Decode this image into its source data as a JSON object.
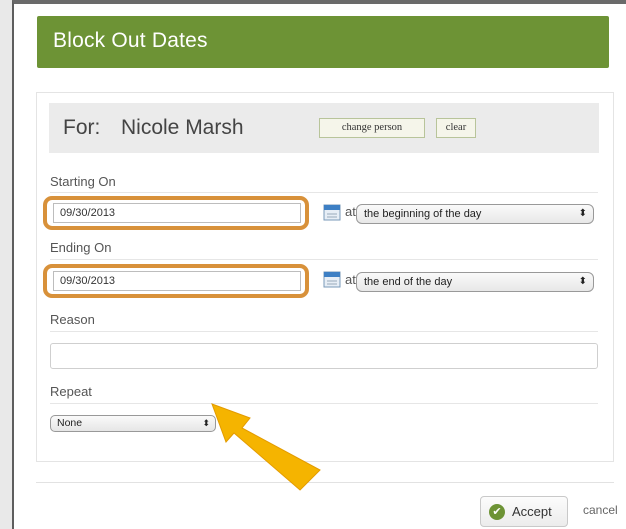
{
  "dialog": {
    "title": "Block Out Dates",
    "for_label": "For:",
    "person_name": "Nicole Marsh",
    "change_person_label": "change person",
    "clear_label": "clear"
  },
  "form": {
    "starting_on_label": "Starting On",
    "start_date": "09/30/2013",
    "at_label": "at",
    "start_time_option": "the beginning of the day",
    "ending_on_label": "Ending On",
    "end_date": "09/30/2013",
    "end_time_option": "the end of the day",
    "reason_label": "Reason",
    "reason_value": "",
    "repeat_label": "Repeat",
    "repeat_option": "None",
    "select_arrows": "⬍"
  },
  "footer": {
    "accept_label": "Accept",
    "cancel_label": "cancel",
    "check_glyph": "✔"
  },
  "colors": {
    "header_green": "#6d9335",
    "highlight_orange": "#d8913a",
    "arrow_yellow": "#f5b400"
  },
  "icons": [
    "calendar-icon",
    "check-icon",
    "arrow-annotation"
  ]
}
